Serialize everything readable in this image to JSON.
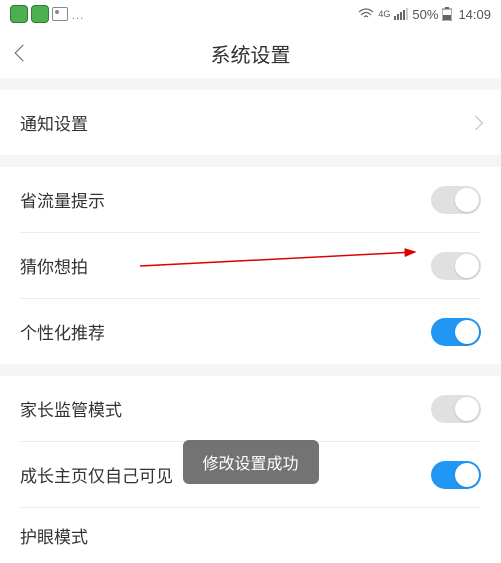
{
  "status": {
    "signal_label": "4G",
    "battery": "50%",
    "time": "14:09"
  },
  "header": {
    "title": "系统设置"
  },
  "rows": {
    "notification": "通知设置",
    "data_saver": "省流量提示",
    "guess_shoot": "猜你想拍",
    "personalized": "个性化推荐",
    "parental": "家长监管模式",
    "growth_private": "成长主页仅自己可见",
    "eye_care": "护眼模式"
  },
  "toggles": {
    "data_saver": false,
    "guess_shoot": false,
    "personalized": true,
    "parental": false,
    "growth_private": true
  },
  "toast": "修改设置成功"
}
